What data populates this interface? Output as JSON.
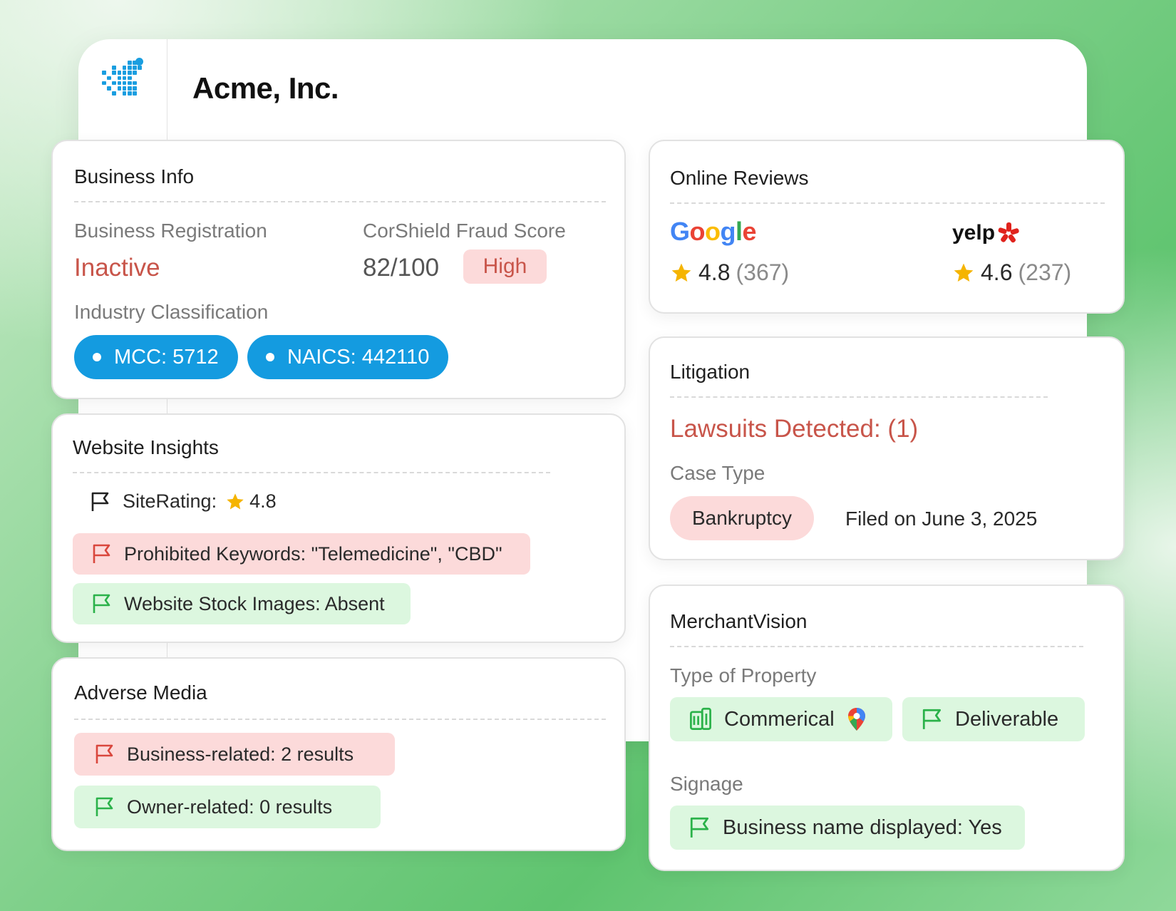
{
  "header": {
    "company": "Acme, Inc."
  },
  "business_info": {
    "title": "Business Info",
    "registration_label": "Business Registration",
    "registration_value": "Inactive",
    "fraud_label": "CorShield Fraud Score",
    "fraud_score": "82/100",
    "fraud_level": "High",
    "industry_label": "Industry Classification",
    "mcc": "MCC: 5712",
    "naics": "NAICS: 442110"
  },
  "website_insights": {
    "title": "Website Insights",
    "site_rating_label": "SiteRating:",
    "site_rating_value": "4.8",
    "prohibited": "Prohibited Keywords: \"Telemedicine\", \"CBD\"",
    "stock_images": "Website Stock Images: Absent"
  },
  "adverse_media": {
    "title": "Adverse Media",
    "business_related": "Business-related: 2 results",
    "owner_related": "Owner-related: 0 results"
  },
  "online_reviews": {
    "title": "Online Reviews",
    "google": {
      "brand": "Google",
      "rating": "4.8",
      "count": "(367)"
    },
    "yelp": {
      "brand": "yelp",
      "rating": "4.6",
      "count": "(237)"
    }
  },
  "litigation": {
    "title": "Litigation",
    "lawsuits": "Lawsuits Detected: (1)",
    "case_type_label": "Case Type",
    "case_type": "Bankruptcy",
    "filed": "Filed on June 3, 2025"
  },
  "merchant_vision": {
    "title": "MerchantVision",
    "property_label": "Type of Property",
    "property_type": "Commerical",
    "deliverable": "Deliverable",
    "signage_label": "Signage",
    "signage_value": "Business name displayed: Yes"
  },
  "colors": {
    "alert_red": "#c8554a",
    "chip_blue": "#149be0",
    "flag_red": "#d9473d",
    "flag_green": "#2bb24a",
    "star": "#f5b400"
  }
}
